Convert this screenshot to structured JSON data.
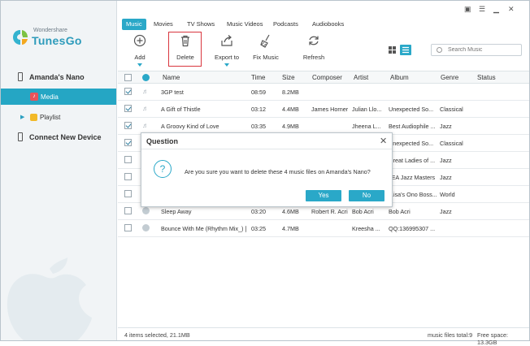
{
  "app": {
    "logo_small": "Wondershare",
    "logo_name": "TunesGo"
  },
  "sidebar": {
    "device_name": "Amanda's Nano",
    "items": [
      {
        "label": "Media"
      },
      {
        "label": "Playlist"
      }
    ],
    "connect_label": "Connect New Device"
  },
  "tabs": [
    "Music",
    "Movies",
    "TV Shows",
    "Music Videos",
    "Podcasts",
    "Audiobooks"
  ],
  "toolbar": {
    "add": "Add",
    "delete": "Delete",
    "export": "Export to",
    "fix": "Fix Music",
    "refresh": "Refresh"
  },
  "search": {
    "placeholder": "Search Music"
  },
  "columns": [
    "Name",
    "Time",
    "Size",
    "Composer",
    "Artist",
    "Album",
    "Genre",
    "Status"
  ],
  "rows": [
    {
      "checked": true,
      "name": "3GP test",
      "time": "08:59",
      "size": "8.2MB",
      "composer": "",
      "artist": "",
      "album": "",
      "genre": ""
    },
    {
      "checked": true,
      "name": "A Gift of Thistle",
      "time": "03:12",
      "size": "4.4MB",
      "composer": "James Horner",
      "artist": "Julian Llo...",
      "album": "Unexpected So...",
      "genre": "Classical"
    },
    {
      "checked": true,
      "name": "A Groovy Kind of Love",
      "time": "03:35",
      "size": "4.9MB",
      "composer": "",
      "artist": "Jheena L...",
      "album": "Best Audiophile ...",
      "genre": "Jazz"
    },
    {
      "checked": true,
      "name": "",
      "time": "",
      "size": "",
      "composer": "",
      "artist": "",
      "album": "Unexpected So...",
      "genre": "Classical"
    },
    {
      "checked": false,
      "name": "",
      "time": "",
      "size": "",
      "composer": "",
      "artist": "",
      "album": "Great Ladies of ...",
      "genre": "Jazz"
    },
    {
      "checked": false,
      "name": "",
      "time": "",
      "size": "",
      "composer": "",
      "artist": "",
      "album": "JEA Jazz Masters",
      "genre": "Jazz"
    },
    {
      "checked": false,
      "name": "",
      "time": "",
      "size": "",
      "composer": "",
      "artist": "",
      "album": "...isa's Ono Boss...",
      "genre": "World"
    },
    {
      "checked": false,
      "name": "Sleep Away",
      "time": "03:20",
      "size": "4.6MB",
      "composer": "Robert R. Acri",
      "artist": "Bob Acri",
      "album": "Bob Acri",
      "genre": "Jazz"
    },
    {
      "checked": false,
      "name": "Bounce With Me (Rhythm Mix_) [",
      "time": "03:25",
      "size": "4.7MB",
      "composer": "",
      "artist": "Kreesha ...",
      "album": "QQ:136995307 ...",
      "genre": ""
    }
  ],
  "status": {
    "selected": "4 items selected, 21.1MB",
    "total": "music files total:9",
    "free": "Free space: 13.3GB"
  },
  "dialog": {
    "title": "Question",
    "message": "Are you sure you want to delete these 4 music files on Amanda's Nano?",
    "yes": "Yes",
    "no": "No"
  },
  "colors": {
    "accent": "#2aa8c8",
    "highlight": "#d9363e"
  }
}
